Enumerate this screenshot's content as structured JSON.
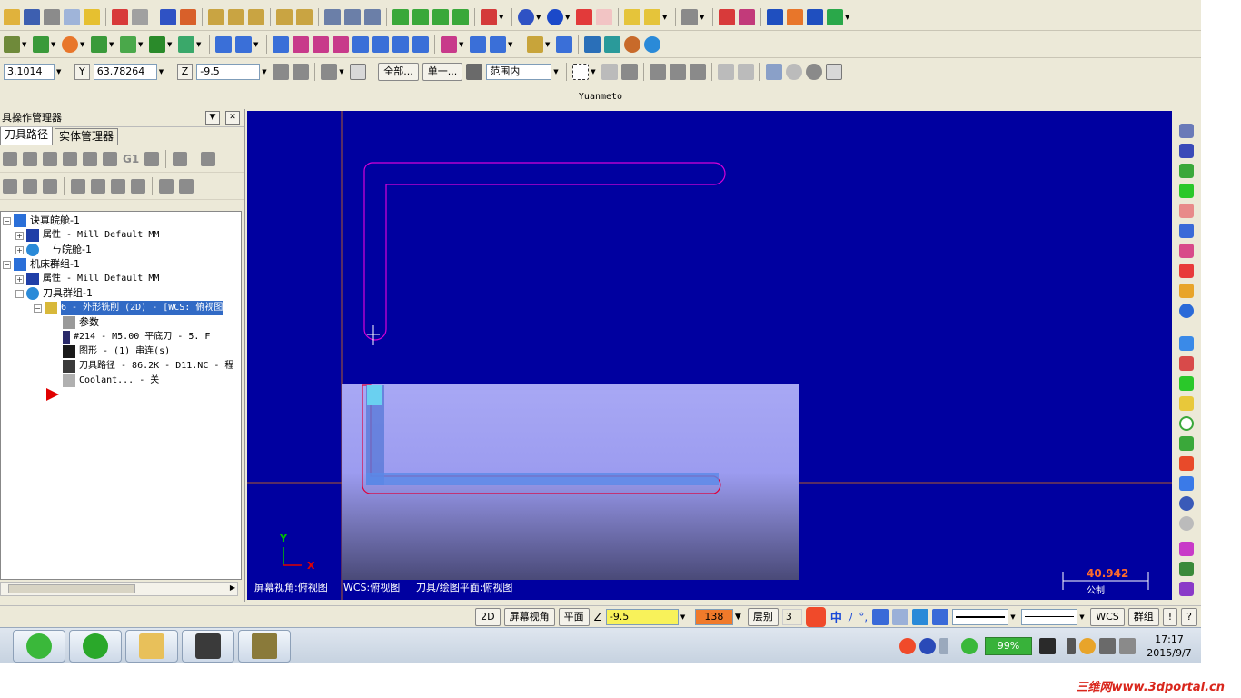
{
  "window_title": "Yuanmeto",
  "coords": {
    "x_value": "3.1014",
    "y_label": "Y",
    "y_value": "63.78264",
    "z_label": "Z",
    "z_value": "-9.5",
    "all_label": "全部...",
    "single_label": "单一...",
    "range_value": "范围内"
  },
  "left_panel": {
    "title": "具操作管理器",
    "tabs": [
      "刀具路径",
      "实体管理器"
    ],
    "row2_text": "G1",
    "tree": [
      {
        "pm": "−",
        "text": "诀真皖舱-1",
        "mono": false
      },
      {
        "pm": "+",
        "text": "属性 - Mill Default MM",
        "mono": true
      },
      {
        "pm": "+",
        "text": "ㄣ皖舱-1",
        "mono": false
      },
      {
        "pm": "−",
        "text": "机床群组-1",
        "mono": false
      },
      {
        "pm": "+",
        "text": "属性 - Mill Default MM",
        "mono": true
      },
      {
        "pm": "−",
        "text": "刀具群组-1",
        "mono": false
      },
      {
        "pm": "−",
        "text": "6 - 外形铣削 (2D) - [WCS: 俯视图",
        "mono": true
      },
      {
        "pm": "",
        "text": "参数",
        "mono": false
      },
      {
        "pm": "",
        "text": "#214 - M5.00 平底刀 -   5. F",
        "mono": true
      },
      {
        "pm": "",
        "text": "图形 - (1) 串连(s)",
        "mono": true
      },
      {
        "pm": "",
        "text": "刀具路径 - 86.2K - D11.NC - 程",
        "mono": true
      },
      {
        "pm": "",
        "text": "Coolant... - 关",
        "mono": true
      }
    ]
  },
  "viewport": {
    "screen_view": "屏幕视角:俯视图",
    "wcs": "WCS:俯视图",
    "tplane": "刀具/绘图平面:俯视图",
    "axis_x": "X",
    "axis_y": "Y",
    "scale_value": "40.942",
    "scale_unit": "公制"
  },
  "statusbar": {
    "mode_2d": "2D",
    "screen_view_btn": "屏幕视角",
    "plane_btn": "平面",
    "z_label": "Z",
    "z_value": "-9.5",
    "color_value": "138",
    "level_label": "层别",
    "level_value": "3",
    "ime_chars": [
      "中",
      "ﾉ",
      "°,"
    ],
    "wcs_btn": "WCS",
    "group_btn": "群组",
    "excl": "!",
    "help": "?"
  },
  "taskbar": {
    "battery": "99%",
    "time": "17:17",
    "date": "2015/9/7"
  },
  "watermark": "三维网www.3dportal.cn"
}
